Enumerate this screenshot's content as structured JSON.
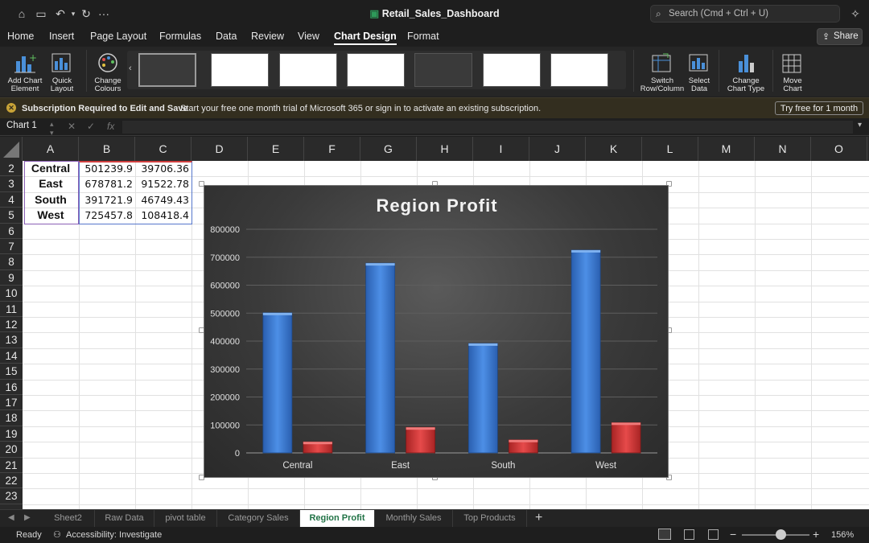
{
  "app": {
    "title": "Retail_Sales_Dashboard",
    "search_placeholder": "Search (Cmd + Ctrl + U)",
    "share_label": "Share"
  },
  "menu": [
    "Home",
    "Insert",
    "Page Layout",
    "Formulas",
    "Data",
    "Review",
    "View",
    "Chart Design",
    "Format"
  ],
  "ribbon": {
    "add_chart_element": [
      "Add Chart",
      "Element"
    ],
    "quick_layout": [
      "Quick",
      "Layout"
    ],
    "change_colours": [
      "Change",
      "Colours"
    ],
    "switch_row_column": [
      "Switch",
      "Row/Column"
    ],
    "select_data": [
      "Select",
      "Data"
    ],
    "change_chart_type": [
      "Change",
      "Chart Type"
    ],
    "move_chart": [
      "Move",
      "Chart"
    ]
  },
  "notice": {
    "title": "Subscription Required to Edit and Save",
    "message": "Start your free one month trial of Microsoft 365 or sign in to activate an existing subscription.",
    "button": "Try free for 1 month"
  },
  "formula_bar": {
    "name_box": "Chart 1",
    "fx": "fx",
    "formula": ""
  },
  "columns": [
    "A",
    "B",
    "C",
    "D",
    "E",
    "F",
    "G",
    "H",
    "I",
    "J",
    "K",
    "L",
    "M",
    "N",
    "O"
  ],
  "rows": [
    "2",
    "3",
    "4",
    "5",
    "6",
    "7",
    "8",
    "9",
    "10",
    "11",
    "12",
    "13",
    "14",
    "15",
    "16",
    "17",
    "18",
    "19",
    "20",
    "21",
    "22",
    "23"
  ],
  "table": [
    {
      "region": "Central",
      "b": "501239.9",
      "c": "39706.36"
    },
    {
      "region": "East",
      "b": "678781.2",
      "c": "91522.78"
    },
    {
      "region": "South",
      "b": "391721.9",
      "c": "46749.43"
    },
    {
      "region": "West",
      "b": "725457.8",
      "c": "108418.4"
    }
  ],
  "chart_data": {
    "type": "bar",
    "title": "Region Profit",
    "categories": [
      "Central",
      "East",
      "South",
      "West"
    ],
    "series": [
      {
        "values": [
          501239.9,
          678781.2,
          391721.9,
          725457.8
        ],
        "color": "#3a7bd5"
      },
      {
        "values": [
          39706.36,
          91522.78,
          46749.43,
          108418.4
        ],
        "color": "#d43a3a"
      }
    ],
    "ylim": [
      0,
      800000
    ],
    "yticks": [
      "0",
      "100000",
      "200000",
      "300000",
      "400000",
      "500000",
      "600000",
      "700000",
      "800000"
    ],
    "grid": true,
    "legend": "none"
  },
  "sheets": [
    "Sheet2",
    "Raw Data",
    "pivot table",
    "Category Sales",
    "Region Profit",
    "Monthly Sales",
    "Top Products"
  ],
  "active_sheet": "Region Profit",
  "status": {
    "ready": "Ready",
    "accessibility": "Accessibility: Investigate",
    "zoom": "156%"
  }
}
